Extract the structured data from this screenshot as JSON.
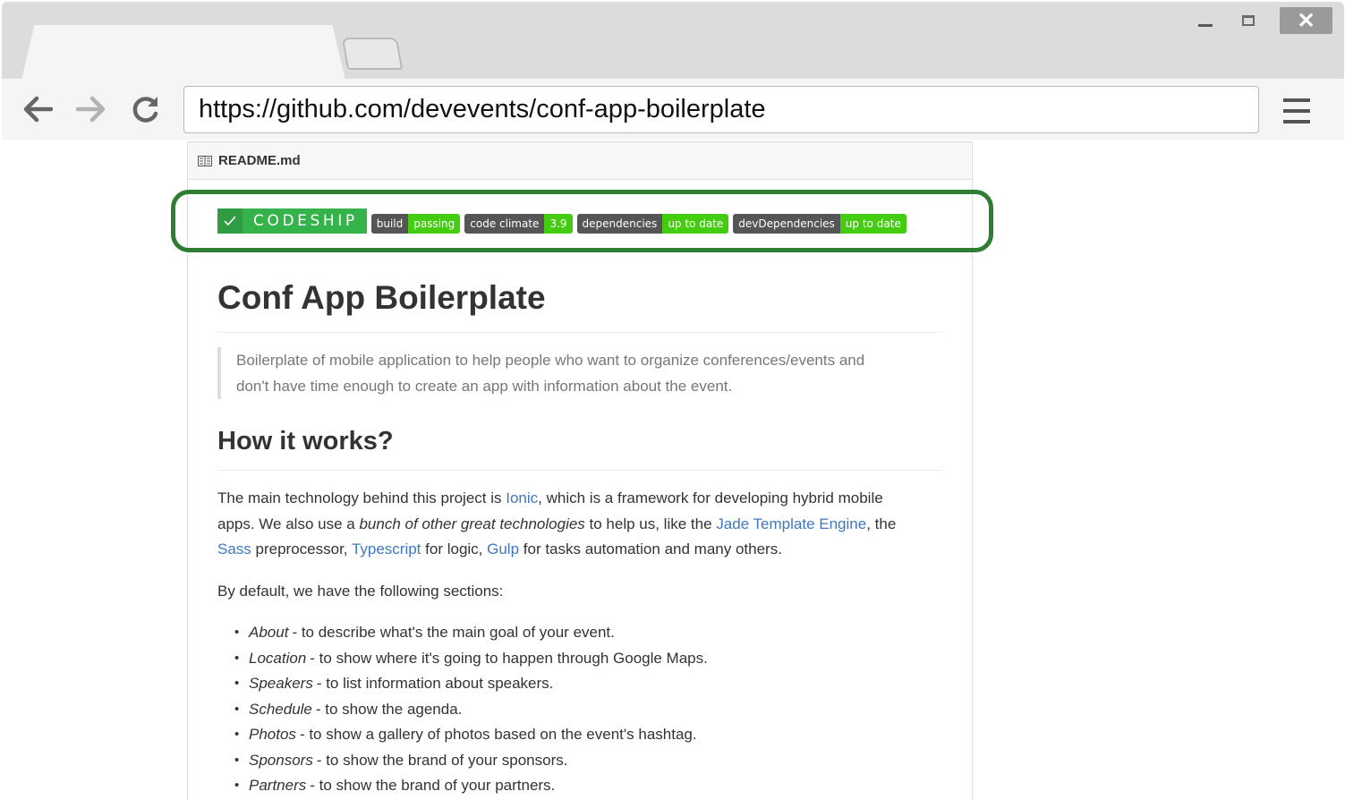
{
  "browser": {
    "url": "https://github.com/devevents/conf-app-boilerplate",
    "close_glyph": "✕"
  },
  "readme": {
    "filename": "README.md",
    "badges": {
      "codeship": "CODESHIP",
      "build": {
        "label": "build",
        "value": "passing"
      },
      "climate": {
        "label": "code climate",
        "value": "3.9"
      },
      "deps": {
        "label": "dependencies",
        "value": "up to date"
      },
      "devdeps": {
        "label": "devDependencies",
        "value": "up to date"
      }
    },
    "title": "Conf App Boilerplate",
    "quote_line1": "Boilerplate of mobile application to help people who want to organize conferences/events and",
    "quote_line2": "don't have time enough to create an app with information about the event.",
    "heading2": "How it works?",
    "p1": {
      "t1": "The main technology behind this project is ",
      "l1": "Ionic",
      "t2": ", which is a framework for developing hybrid mobile",
      "t3": "apps. We also use a ",
      "em1": "bunch of other great technologies",
      "t4": " to help us, like the ",
      "l2": "Jade Template Engine",
      "t5": ", the",
      "l3": "Sass",
      "t6": " preprocessor, ",
      "l4": "Typescript",
      "t7": " for logic, ",
      "l5": "Gulp",
      "t8": " for tasks automation and many others."
    },
    "p2": "By default, we have the following sections:",
    "sections": [
      {
        "term": "About",
        "desc": "- to describe what's the main goal of your event."
      },
      {
        "term": "Location",
        "desc": "- to show where it's going to happen through Google Maps."
      },
      {
        "term": "Speakers",
        "desc": "- to list information about speakers."
      },
      {
        "term": "Schedule",
        "desc": "- to show the agenda."
      },
      {
        "term": "Photos",
        "desc": "- to show a gallery of photos based on the event's hashtag."
      },
      {
        "term": "Sponsors",
        "desc": "- to show the brand of your sponsors."
      },
      {
        "term": "Partners",
        "desc": "- to show the brand of your partners."
      }
    ]
  },
  "colors": {
    "link": "#4078c0",
    "highlight": "#2e7d32",
    "badge_green": "#44cc11",
    "codeship_green": "#36b24a"
  }
}
